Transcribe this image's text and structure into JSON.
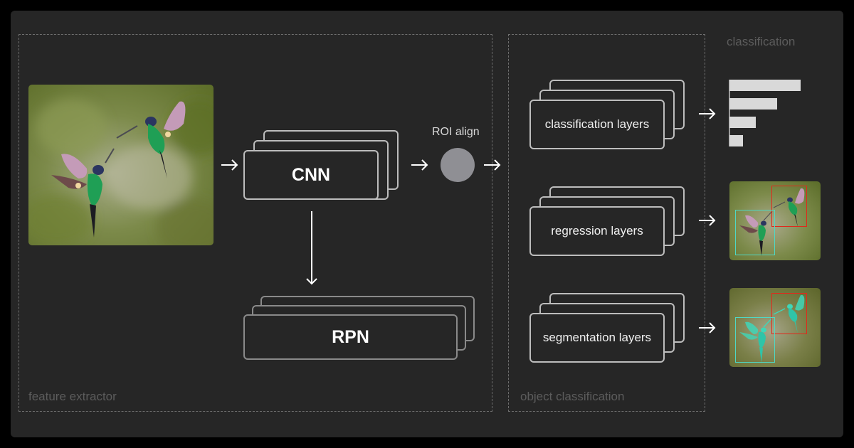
{
  "groups": {
    "feature_extractor": {
      "label": "feature extractor"
    },
    "object_classification": {
      "label": "object classification"
    }
  },
  "blocks": {
    "cnn": {
      "label": "CNN"
    },
    "rpn": {
      "label": "RPN"
    },
    "roi": {
      "label": "ROI align"
    },
    "classification_layers": {
      "label": "classification layers"
    },
    "regression_layers": {
      "label": "regression layers"
    },
    "segmentation_layers": {
      "label": "segmentation layers"
    }
  },
  "outputs": {
    "classification": {
      "title": "classification",
      "bar_values": [
        1.0,
        0.67,
        0.37,
        0.19
      ],
      "bar_color": "#d9d9d9"
    },
    "detection": {
      "box_colors": {
        "bird_1": "#e0291c",
        "bird_2": "#4fd8c4"
      }
    },
    "segmentation": {
      "mask_color": "#3fd6b8",
      "box_colors": {
        "bird_1": "#e0291c",
        "bird_2": "#4fd8c4"
      }
    }
  },
  "input": {
    "description": "photo of two hummingbirds in flight"
  },
  "colors": {
    "background": "#262626",
    "stroke": "#bdbdbd",
    "roi_node": "#8f8f94",
    "arrow": "#ffffff"
  }
}
